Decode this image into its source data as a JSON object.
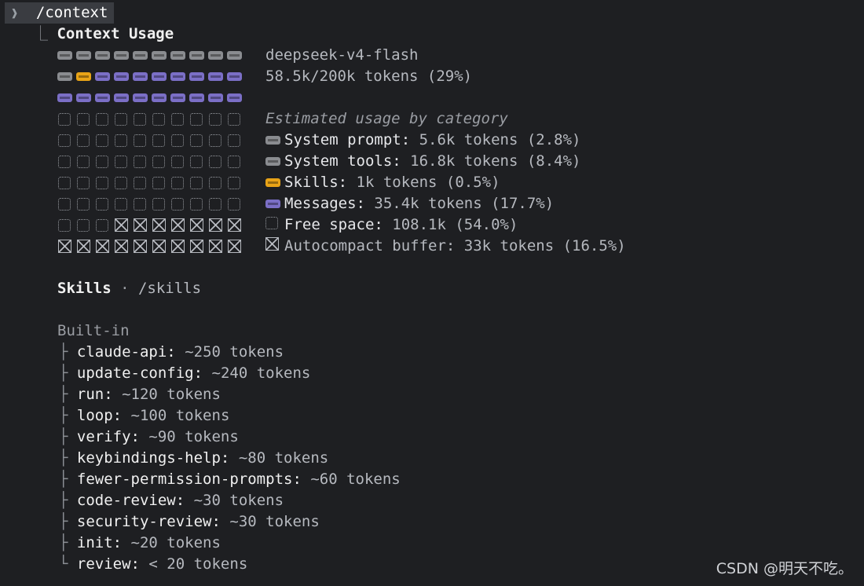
{
  "prompt": {
    "glyph": "❱",
    "command": "/context"
  },
  "context": {
    "tree_glyph": "⎿",
    "title": "Context Usage",
    "model": "deepseek-v4-flash",
    "tokens_summary": "58.5k/200k tokens (29%)",
    "grid": [
      [
        "sys",
        "sys",
        "sys",
        "sys",
        "sys",
        "sys",
        "sys",
        "sys",
        "sys",
        "sys"
      ],
      [
        "sys",
        "skl",
        "msg",
        "msg",
        "msg",
        "msg",
        "msg",
        "msg",
        "msg",
        "msg"
      ],
      [
        "msg",
        "msg",
        "msg",
        "msg",
        "msg",
        "msg",
        "msg",
        "msg",
        "msg",
        "msg"
      ],
      [
        "free",
        "free",
        "free",
        "free",
        "free",
        "free",
        "free",
        "free",
        "free",
        "free"
      ],
      [
        "free",
        "free",
        "free",
        "free",
        "free",
        "free",
        "free",
        "free",
        "free",
        "free"
      ],
      [
        "free",
        "free",
        "free",
        "free",
        "free",
        "free",
        "free",
        "free",
        "free",
        "free"
      ],
      [
        "free",
        "free",
        "free",
        "free",
        "free",
        "free",
        "free",
        "free",
        "free",
        "free"
      ],
      [
        "free",
        "free",
        "free",
        "free",
        "free",
        "free",
        "free",
        "free",
        "free",
        "free"
      ],
      [
        "free",
        "free",
        "free",
        "buf",
        "buf",
        "buf",
        "buf",
        "buf",
        "buf",
        "buf"
      ],
      [
        "buf",
        "buf",
        "buf",
        "buf",
        "buf",
        "buf",
        "buf",
        "buf",
        "buf",
        "buf"
      ]
    ],
    "category_heading": "Estimated usage by category",
    "categories": [
      {
        "kind": "sys",
        "label": "System prompt:",
        "value": " 5.6k tokens (2.8%)"
      },
      {
        "kind": "sys",
        "label": "System tools:",
        "value": " 16.8k tokens (8.4%)"
      },
      {
        "kind": "skl",
        "label": "Skills:",
        "value": " 1k tokens (0.5%)"
      },
      {
        "kind": "msg",
        "label": "Messages:",
        "value": " 35.4k tokens (17.7%)"
      },
      {
        "kind": "free",
        "label": "Free space:",
        "value": " 108.1k (54.0%)"
      },
      {
        "kind": "buf",
        "label": "Autocompact buffer:",
        "value": " 33k tokens (16.5%)"
      }
    ],
    "colors": {
      "sys": "#8a8c90",
      "skl": "#e8a317",
      "msg": "#7b6fc6"
    }
  },
  "skills": {
    "title": "Skills",
    "separator": " · ",
    "command": "/skills",
    "group_label": "Built-in",
    "items": [
      {
        "branch": "├",
        "name": "claude-api:",
        "tokens": " ~250 tokens"
      },
      {
        "branch": "├",
        "name": "update-config:",
        "tokens": " ~240 tokens"
      },
      {
        "branch": "├",
        "name": "run:",
        "tokens": " ~120 tokens"
      },
      {
        "branch": "├",
        "name": "loop:",
        "tokens": " ~100 tokens"
      },
      {
        "branch": "├",
        "name": "verify:",
        "tokens": " ~90 tokens"
      },
      {
        "branch": "├",
        "name": "keybindings-help:",
        "tokens": " ~80 tokens"
      },
      {
        "branch": "├",
        "name": "fewer-permission-prompts:",
        "tokens": " ~60 tokens"
      },
      {
        "branch": "├",
        "name": "code-review:",
        "tokens": " ~30 tokens"
      },
      {
        "branch": "├",
        "name": "security-review:",
        "tokens": " ~30 tokens"
      },
      {
        "branch": "├",
        "name": "init:",
        "tokens": " ~20 tokens"
      },
      {
        "branch": "└",
        "name": "review:",
        "tokens": " < 20 tokens"
      }
    ]
  },
  "watermark": "CSDN @明天不吃。"
}
